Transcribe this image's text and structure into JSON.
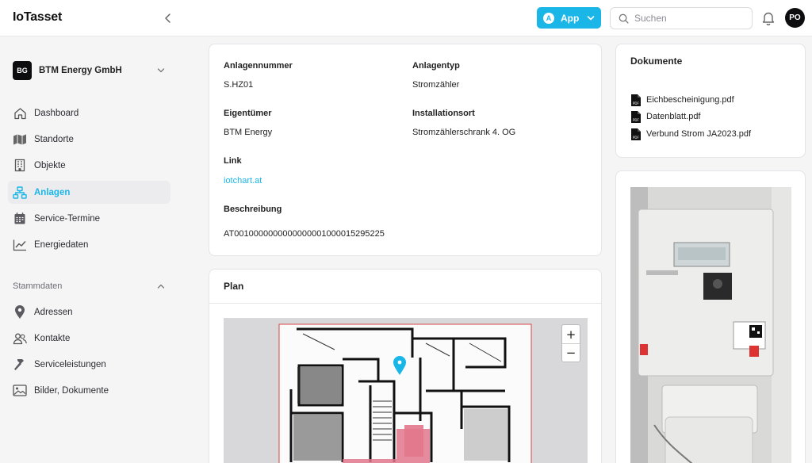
{
  "app": {
    "title": "IoTasset"
  },
  "header": {
    "app_button": {
      "label": "App",
      "badge": "A"
    },
    "search": {
      "placeholder": "Suchen",
      "value": ""
    },
    "avatar_initials": "PO"
  },
  "sidebar": {
    "org": {
      "badge": "BG",
      "name": "BTM Energy GmbH"
    },
    "items": [
      {
        "label": "Dashboard",
        "icon": "home-icon"
      },
      {
        "label": "Standorte",
        "icon": "map-icon"
      },
      {
        "label": "Objekte",
        "icon": "building-icon"
      },
      {
        "label": "Anlagen",
        "icon": "network-icon",
        "active": true
      },
      {
        "label": "Service-Termine",
        "icon": "calendar-icon"
      },
      {
        "label": "Energiedaten",
        "icon": "chart-line-icon"
      }
    ],
    "section": {
      "label": "Stammdaten"
    },
    "section_items": [
      {
        "label": "Adressen",
        "icon": "map-pin-icon"
      },
      {
        "label": "Kontakte",
        "icon": "users-icon"
      },
      {
        "label": "Serviceleistungen",
        "icon": "hammer-icon"
      },
      {
        "label": "Bilder, Dokumente",
        "icon": "image-icon"
      }
    ]
  },
  "details": {
    "anlagennummer": {
      "label": "Anlagennummer",
      "value": "S.HZ01"
    },
    "anlagentyp": {
      "label": "Anlagentyp",
      "value": "Stromzähler"
    },
    "eigentuemer": {
      "label": "Eigentümer",
      "value": "BTM Energy"
    },
    "installationsort": {
      "label": "Installationsort",
      "value": "Stromzählerschrank 4. OG"
    },
    "link": {
      "label": "Link",
      "value": "iotchart.at"
    },
    "beschreibung": {
      "label": "Beschreibung",
      "value": "AT0010000000000000001000015295225"
    }
  },
  "plan": {
    "title": "Plan",
    "zoom_in": "+",
    "zoom_out": "−"
  },
  "documents": {
    "title": "Dokumente",
    "items": [
      {
        "name": "Eichbescheinigung.pdf",
        "icon": "pdf-file-icon"
      },
      {
        "name": "Datenblatt.pdf",
        "icon": "pdf-file-icon"
      },
      {
        "name": "Verbund Strom JA2023.pdf",
        "icon": "pdf-file-icon"
      }
    ]
  },
  "colors": {
    "accent": "#1ab6e8",
    "sidebar_active_bg": "#ececee",
    "background": "#f5f5f6"
  }
}
